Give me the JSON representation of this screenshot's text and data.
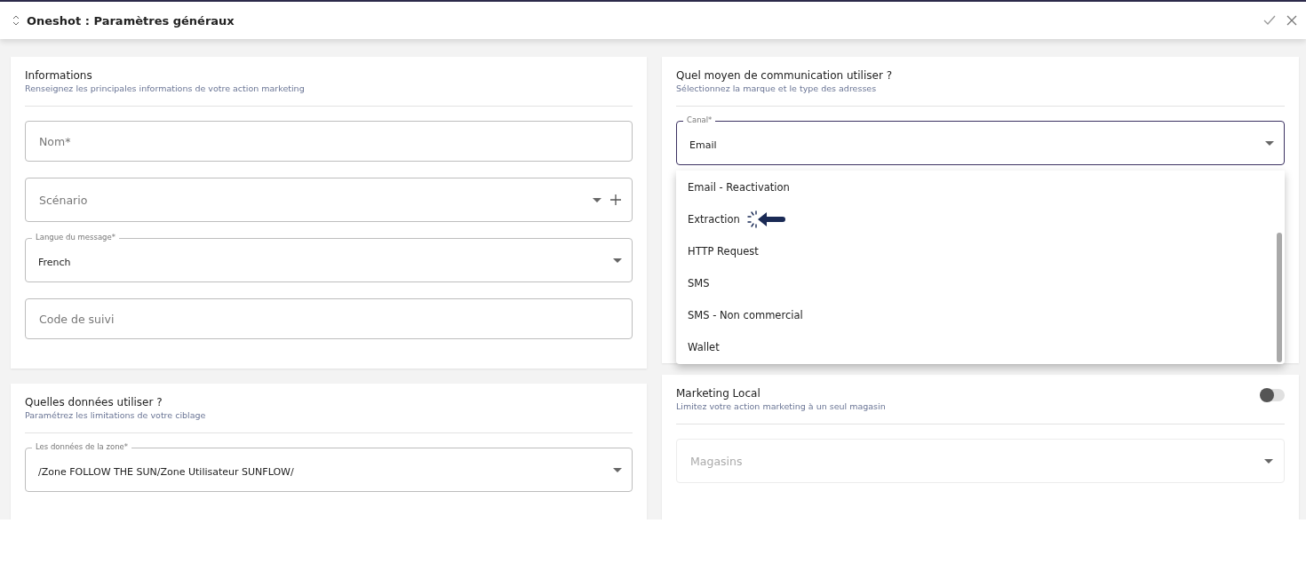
{
  "header": {
    "title": "Oneshot : Paramètres généraux"
  },
  "left_cards": [
    {
      "title": "Informations",
      "subtitle": "Renseignez les principales informations de votre action marketing",
      "fields": [
        {
          "kind": "input",
          "placeholder": "Nom*"
        },
        {
          "kind": "select_add",
          "placeholder": "Scénario"
        },
        {
          "kind": "select",
          "label": "Langue du message*",
          "value": "French"
        },
        {
          "kind": "input",
          "placeholder": "Code de suivi"
        }
      ]
    },
    {
      "title": "Quelles données utiliser ?",
      "subtitle": "Paramétrez les limitations de votre ciblage",
      "fields": [
        {
          "kind": "select",
          "label": "Les données de la zone*",
          "value": "/Zone FOLLOW THE SUN/Zone Utilisateur SUNFLOW/"
        }
      ]
    }
  ],
  "communication": {
    "title": "Quel moyen de communication utiliser ?",
    "subtitle": "Sélectionnez la marque et le type des adresses",
    "canal": {
      "label": "Canal*",
      "value": "Email",
      "focused": true,
      "expanded": true
    },
    "options": [
      {
        "label": "Email - Reactivation",
        "selected": false
      },
      {
        "label": "Extraction",
        "selected": false
      },
      {
        "label": "HTTP Request",
        "selected": false
      },
      {
        "label": "SMS",
        "selected": false
      },
      {
        "label": "SMS - Non commercial",
        "selected": false
      },
      {
        "label": "Wallet",
        "selected": false
      }
    ]
  },
  "marketing_local": {
    "title": "Marketing Local",
    "subtitle": "Limitez votre action marketing à un seul magasin",
    "on": false,
    "stores": {
      "placeholder": "Magasins",
      "disabled": true
    }
  }
}
